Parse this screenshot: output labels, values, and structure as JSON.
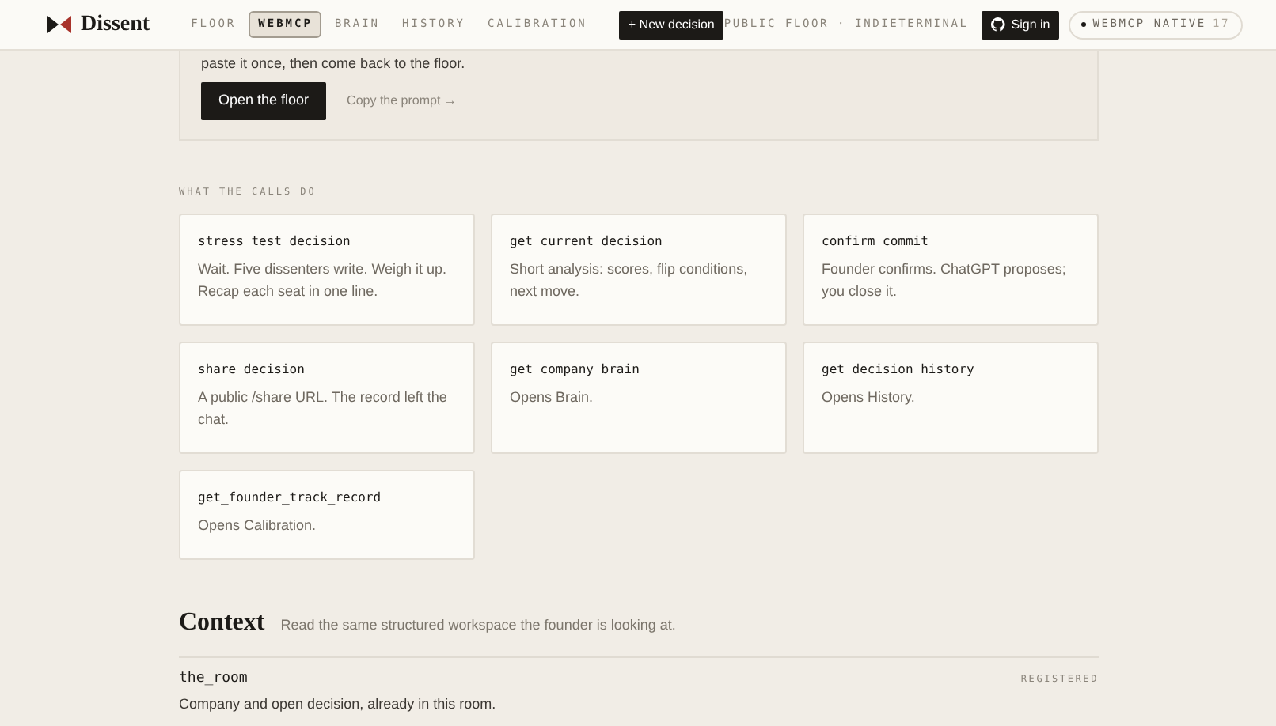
{
  "header": {
    "brand": "Dissent",
    "nav": [
      {
        "label": "FLOOR",
        "selected": false
      },
      {
        "label": "WEBMCP",
        "selected": true
      },
      {
        "label": "BRAIN",
        "selected": false
      },
      {
        "label": "HISTORY",
        "selected": false
      },
      {
        "label": "CALIBRATION",
        "selected": false
      }
    ],
    "new_button": "+ New decision",
    "context": "PUBLIC FLOOR · INDIETERMINAL",
    "sign_in": "Sign in",
    "badge": {
      "label": "WEBMCP NATIVE",
      "count": "17"
    }
  },
  "intro": {
    "text": "paste it once, then come back to the floor.",
    "primary_button": "Open the floor",
    "link": "Copy the prompt →"
  },
  "calls": {
    "label": "WHAT THE CALLS DO",
    "items": [
      {
        "name": "stress_test_decision",
        "description": "Wait. Five dissenters write. Weigh it up. Recap each seat in one line."
      },
      {
        "name": "get_current_decision",
        "description": "Short analysis: scores, flip conditions, next move."
      },
      {
        "name": "confirm_commit",
        "description": "Founder confirms. ChatGPT proposes; you close it."
      },
      {
        "name": "share_decision",
        "description": "A public /share URL. The record left the chat."
      },
      {
        "name": "get_company_brain",
        "description": "Opens Brain."
      },
      {
        "name": "get_decision_history",
        "description": "Opens History."
      },
      {
        "name": "get_founder_track_record",
        "description": "Opens Calibration."
      }
    ]
  },
  "context": {
    "title": "Context",
    "subtitle": "Read the same structured workspace the founder is looking at.",
    "items": [
      {
        "name": "the_room",
        "status": "REGISTERED",
        "description": "Company and open decision, already in this room."
      }
    ]
  }
}
